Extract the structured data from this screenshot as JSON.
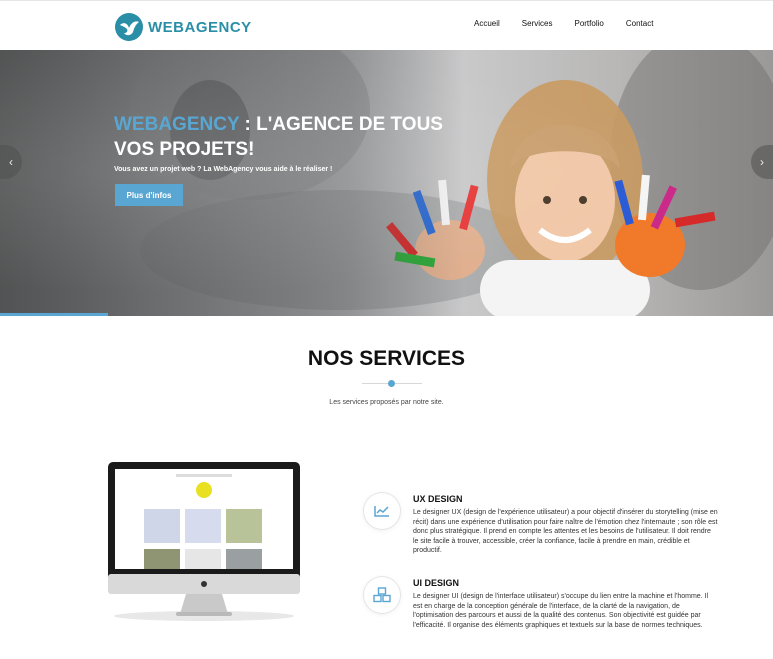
{
  "header": {
    "logo_text": "WEBAGENCY",
    "nav": [
      "Accueil",
      "Services",
      "Portfolio",
      "Contact"
    ]
  },
  "hero": {
    "title_brand": "WEBAGENCY",
    "title_rest": " : L'AGENCE DE TOUS VOS PROJETS!",
    "subtitle": "Vous avez un projet web ? La WebAgency vous aide à le réaliser !",
    "button_label": "Plus d'infos",
    "prev_arrow": "‹",
    "next_arrow": "›",
    "slide_progress": 0.14
  },
  "services_section": {
    "title": "NOS SERVICES",
    "subtitle": "Les services proposés par notre site."
  },
  "services": [
    {
      "icon": "chart-line-icon",
      "title": "UX DESIGN",
      "description": "Le designer UX (design de l'expérience utilisateur) a pour objectif d'insérer du storytelling (mise en récit) dans une expérience d'utilisation pour faire naître de l'émotion chez l'internaute ; son rôle est donc plus stratégique. Il prend en compte les attentes et les besoins de l'utilisateur. Il doit rendre le site facile à trouver, accessible, créer la confiance, facile à prendre en main, crédible et productif."
    },
    {
      "icon": "cubes-icon",
      "title": "UI DESIGN",
      "description": "Le designer UI (design de l'interface utilisateur) s'occupe du lien entre la machine et l'homme. Il est en charge de la conception générale de l'interface, de la clarté de la navigation, de l'optimisation des parcours et aussi de la qualité des contenus. Son objectivité est guidée par l'efficacité. Il organise des éléments graphiques et textuels sur la base de normes techniques."
    }
  ],
  "colors": {
    "accent": "#5aa6d2",
    "logo": "#2a8fa6"
  }
}
